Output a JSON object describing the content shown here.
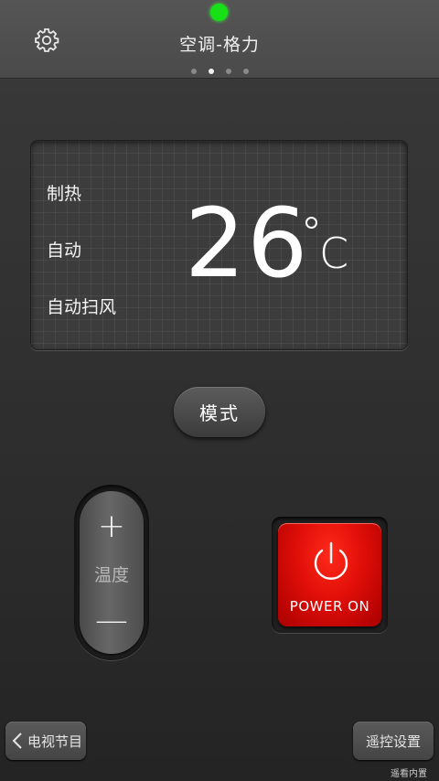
{
  "header": {
    "title": "空调-格力",
    "settings_icon": "gear-icon",
    "page_count": 4,
    "active_page": 2
  },
  "display": {
    "mode": "制热",
    "fan_speed": "自动",
    "swing": "自动扫风",
    "temperature": "26",
    "unit": "C"
  },
  "controls": {
    "mode_label": "模式",
    "temp_plus": "+",
    "temp_label": "温度",
    "temp_minus": "—",
    "power_label": "POWER ON",
    "power_icon": "power-icon",
    "power_color": "#e3130c"
  },
  "footer": {
    "back_label": "电视节目",
    "back_icon": "chevron-left-icon",
    "remote_settings_label": "遥控设置",
    "watermark": "遥看内置"
  },
  "status": {
    "indicator_color": "#17e017"
  }
}
